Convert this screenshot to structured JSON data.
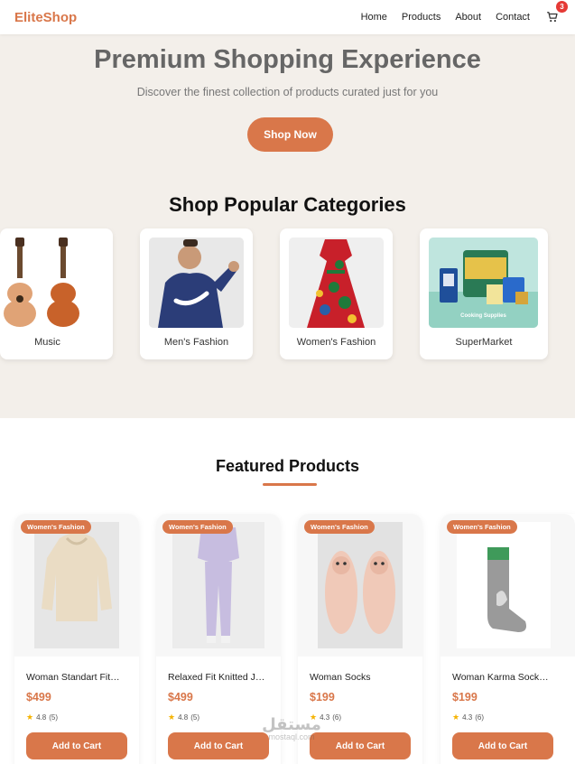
{
  "nav": {
    "brand": "EliteShop",
    "links": [
      "Home",
      "Products",
      "About",
      "Contact"
    ],
    "cart_count": "3"
  },
  "hero": {
    "title": "Premium Shopping Experience",
    "subtitle": "Discover the finest collection of products curated just for you",
    "cta": "Shop Now"
  },
  "categories": {
    "title": "Shop Popular Categories",
    "items": [
      {
        "label": "Music",
        "image": "guitars-image"
      },
      {
        "label": "Men's Fashion",
        "image": "hoodie-image"
      },
      {
        "label": "Women's Fashion",
        "image": "dress-image"
      },
      {
        "label": "SuperMarket",
        "image": "groceries-image",
        "caption": "Cooking Supplies"
      }
    ]
  },
  "featured": {
    "title": "Featured Products",
    "products": [
      {
        "badge": "Women's Fashion",
        "name": "Woman Standart Fit…",
        "price": "$499",
        "rating": "4.8",
        "reviews": "(5)",
        "cta": "Add to Cart"
      },
      {
        "badge": "Women's Fashion",
        "name": "Relaxed Fit Knitted J…",
        "price": "$499",
        "rating": "4.8",
        "reviews": "(5)",
        "cta": "Add to Cart"
      },
      {
        "badge": "Women's Fashion",
        "name": "Woman Socks",
        "price": "$199",
        "rating": "4.3",
        "reviews": "(6)",
        "cta": "Add to Cart"
      },
      {
        "badge": "Women's Fashion",
        "name": "Woman Karma Sock…",
        "price": "$199",
        "rating": "4.3",
        "reviews": "(6)",
        "cta": "Add to Cart"
      }
    ]
  },
  "watermark": {
    "text": "mostaql.com",
    "arabic": "مستقل"
  },
  "colors": {
    "accent": "#d9774a",
    "hero_bg": "#f3efea",
    "badge_red": "#e53935",
    "star": "#f5b301"
  }
}
